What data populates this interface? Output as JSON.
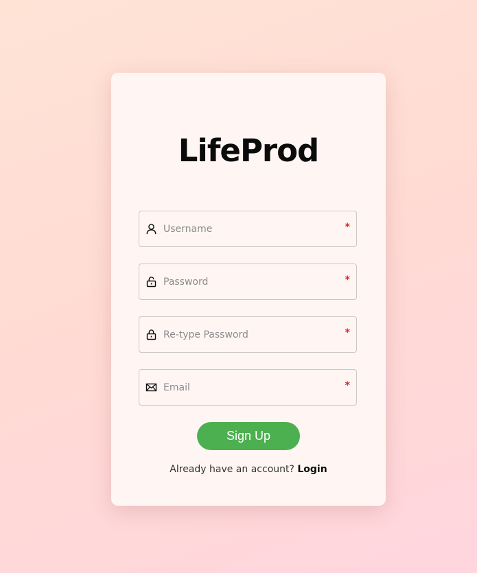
{
  "app": {
    "title": "LifeProd"
  },
  "form": {
    "fields": [
      {
        "icon": "user-icon",
        "placeholder": "Username",
        "required_mark": "*"
      },
      {
        "icon": "unlock-icon",
        "placeholder": "Password",
        "required_mark": "*"
      },
      {
        "icon": "lock-icon",
        "placeholder": "Re-type Password",
        "required_mark": "*"
      },
      {
        "icon": "envelope-icon",
        "placeholder": "Email",
        "required_mark": "*"
      }
    ],
    "submit_label": "Sign Up"
  },
  "footer": {
    "prompt": "Already have an account?",
    "link_label": "Login"
  },
  "colors": {
    "accent": "#4caf50",
    "required": "#e02020"
  }
}
